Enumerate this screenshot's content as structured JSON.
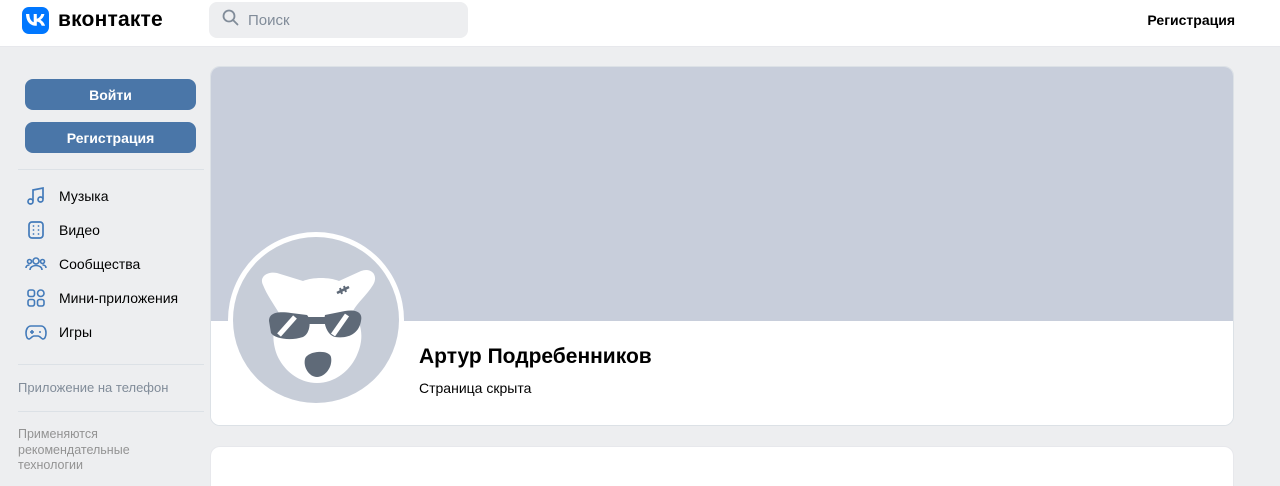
{
  "header": {
    "logo_text": "вконтакте",
    "search_placeholder": "Поиск",
    "register_link": "Регистрация"
  },
  "sidebar": {
    "login_button": "Войти",
    "register_button": "Регистрация",
    "menu": [
      {
        "label": "Музыка",
        "icon": "music-icon"
      },
      {
        "label": "Видео",
        "icon": "video-icon"
      },
      {
        "label": "Сообщества",
        "icon": "communities-icon"
      },
      {
        "label": "Мини-приложения",
        "icon": "mini-apps-icon"
      },
      {
        "label": "Игры",
        "icon": "games-icon"
      }
    ],
    "app_link": "Приложение на телефон",
    "recommendation_note": "Применяются рекомендательные технологии"
  },
  "profile": {
    "name": "Артур Подребенников",
    "status": "Страница скрыта"
  },
  "colors": {
    "accent": "#4a76a8",
    "brand": "#0077ff",
    "cover": "#c8cedb",
    "icon": "#447bba"
  }
}
